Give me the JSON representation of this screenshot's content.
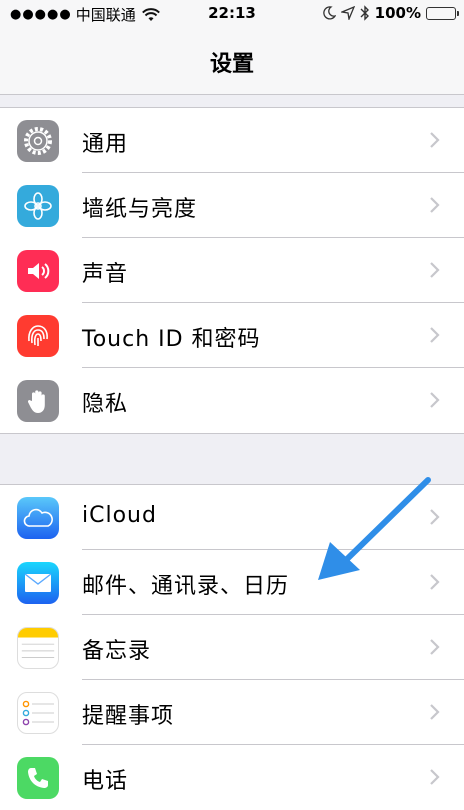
{
  "status_bar": {
    "signal_dots": "●●●●●",
    "carrier": "中国联通",
    "time": "22:13",
    "battery_percent": "100%",
    "icons": [
      "wifi-icon",
      "moon-icon",
      "location-icon",
      "bluetooth-icon",
      "battery-icon"
    ]
  },
  "nav": {
    "title": "设置"
  },
  "groups": [
    {
      "items": [
        {
          "label": "通用",
          "icon": "gear-icon",
          "color": "#8e8e93"
        },
        {
          "label": "墙纸与亮度",
          "icon": "flower-icon",
          "color": "#34aadc"
        },
        {
          "label": "声音",
          "icon": "speaker-icon",
          "color": "#ff2d55"
        },
        {
          "label": "Touch ID 和密码",
          "icon": "fingerprint-icon",
          "color": "#ff3b30"
        },
        {
          "label": "隐私",
          "icon": "hand-icon",
          "color": "#8e8e93"
        }
      ]
    },
    {
      "items": [
        {
          "label": "iCloud",
          "icon": "cloud-icon",
          "color": "#1d8af7"
        },
        {
          "label": "邮件、通讯录、日历",
          "icon": "mail-icon",
          "color": "#1d8af7"
        },
        {
          "label": "备忘录",
          "icon": "notes-icon",
          "color": "#ffcc00"
        },
        {
          "label": "提醒事项",
          "icon": "reminders-icon",
          "color": "#ffffff"
        },
        {
          "label": "电话",
          "icon": "phone-icon",
          "color": "#4cd964"
        }
      ]
    }
  ],
  "accent_colors": {
    "annotation_arrow": "#2f8ee8",
    "separator": "#c8c7cc",
    "chevron": "#c7c7cc"
  }
}
